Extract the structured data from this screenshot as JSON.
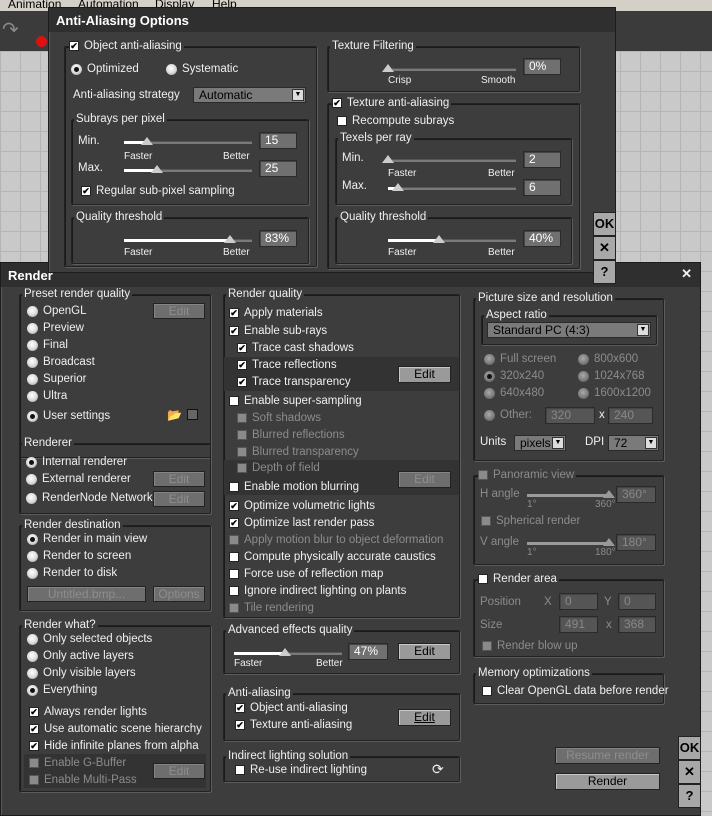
{
  "menu": [
    "Animation",
    "Automation",
    "Display",
    "Help"
  ],
  "aa": {
    "title": "Anti-Aliasing Options",
    "object_aa": {
      "label": "Object anti-aliasing",
      "checked": true
    },
    "optimized": {
      "label": "Optimized",
      "selected": true
    },
    "systematic": {
      "label": "Systematic",
      "selected": false
    },
    "strategy_label": "Anti-aliasing strategy",
    "strategy_value": "Automatic",
    "subrays_title": "Subrays per pixel",
    "min_label": "Min.",
    "max_label": "Max.",
    "faster": "Faster",
    "better": "Better",
    "subrays_min": {
      "value": "15",
      "fraction": 0.18
    },
    "subrays_max": {
      "value": "25",
      "fraction": 0.26
    },
    "regular_sampling": {
      "label": "Regular sub-pixel sampling",
      "checked": true
    },
    "quality_title": "Quality threshold",
    "object_quality": {
      "value": "83%",
      "fraction": 0.83
    },
    "texture_filtering_title": "Texture Filtering",
    "crisp": "Crisp",
    "smooth": "Smooth",
    "texture_filtering": {
      "value": "0%",
      "fraction": 0.0
    },
    "texture_aa": {
      "label": "Texture anti-aliasing",
      "checked": true
    },
    "recompute": {
      "label": "Recompute subrays",
      "checked": false
    },
    "texels_title": "Texels per ray",
    "texels_min": {
      "value": "2",
      "fraction": 0.0
    },
    "texels_max": {
      "value": "6",
      "fraction": 0.08
    },
    "texture_quality": {
      "value": "40%",
      "fraction": 0.4
    },
    "ok": "OK",
    "cancel": "✕",
    "help": "?"
  },
  "render": {
    "title": "Render",
    "close": "✕",
    "preset_title": "Preset render quality",
    "presets": [
      {
        "label": "OpenGL",
        "selected": false
      },
      {
        "label": "Preview",
        "selected": false
      },
      {
        "label": "Final",
        "selected": false
      },
      {
        "label": "Broadcast",
        "selected": false
      },
      {
        "label": "Superior",
        "selected": false
      },
      {
        "label": "Ultra",
        "selected": false
      },
      {
        "label": "User settings",
        "selected": true
      }
    ],
    "edit": {
      "label": "Edit",
      "disabled": true
    },
    "edit_on": {
      "label": "Edit",
      "disabled": false
    },
    "renderer_title": "Renderer",
    "renderers": [
      {
        "label": "Internal renderer",
        "selected": true
      },
      {
        "label": "External renderer",
        "selected": false
      },
      {
        "label": "RenderNode Network",
        "selected": false
      }
    ],
    "dest_title": "Render destination",
    "destinations": [
      {
        "label": "Render in main view",
        "selected": true
      },
      {
        "label": "Render to screen",
        "selected": false
      },
      {
        "label": "Render to disk",
        "selected": false
      }
    ],
    "filename": {
      "label": "Untitled.bmp...",
      "disabled": true
    },
    "options": {
      "label": "Options",
      "disabled": true
    },
    "what_title": "Render what?",
    "what": [
      {
        "label": "Only selected objects",
        "selected": false
      },
      {
        "label": "Only active layers",
        "selected": false
      },
      {
        "label": "Only visible layers",
        "selected": false
      },
      {
        "label": "Everything",
        "selected": true
      }
    ],
    "what_checks": [
      {
        "label": "Always render lights",
        "checked": true
      },
      {
        "label": "Use automatic scene hierarchy",
        "checked": true
      },
      {
        "label": "Hide infinite planes from alpha",
        "checked": true
      },
      {
        "label": "Enable G-Buffer",
        "checked": false,
        "disabled": true
      },
      {
        "label": "Enable Multi-Pass",
        "checked": false,
        "disabled": true
      }
    ],
    "quality_title": "Render quality",
    "quality": [
      {
        "label": "Apply materials",
        "checked": true
      },
      {
        "label": "Enable sub-rays",
        "checked": true
      },
      {
        "label": "Trace cast shadows",
        "checked": true
      },
      {
        "label": "Trace reflections",
        "checked": true
      },
      {
        "label": "Trace transparency",
        "checked": true
      },
      {
        "label": "Enable super-sampling",
        "checked": false
      },
      {
        "label": "Soft shadows",
        "checked": false,
        "disabled": true
      },
      {
        "label": "Blurred reflections",
        "checked": false,
        "disabled": true
      },
      {
        "label": "Blurred transparency",
        "checked": false,
        "disabled": true
      },
      {
        "label": "Depth of field",
        "checked": false,
        "disabled": true
      },
      {
        "label": "Enable motion blurring",
        "checked": false
      },
      {
        "label": "Optimize volumetric lights",
        "checked": true
      },
      {
        "label": "Optimize last render pass",
        "checked": true
      },
      {
        "label": "Apply motion blur to object deformation",
        "checked": false,
        "disabled": true
      },
      {
        "label": "Compute physically accurate caustics",
        "checked": false
      },
      {
        "label": "Force use of reflection map",
        "checked": false
      },
      {
        "label": "Ignore indirect lighting on plants",
        "checked": false
      },
      {
        "label": "Tile rendering",
        "checked": false,
        "disabled": true
      }
    ],
    "advanced_title": "Advanced effects quality",
    "faster": "Faster",
    "better": "Better",
    "advanced": {
      "value": "47%",
      "fraction": 0.47
    },
    "aa_title": "Anti-aliasing",
    "aa_checks": [
      {
        "label": "Object anti-aliasing",
        "checked": true
      },
      {
        "label": "Texture anti-aliasing",
        "checked": true
      }
    ],
    "indirect_title": "Indirect lighting solution",
    "reuse_indirect": {
      "label": "Re-use indirect lighting",
      "checked": false
    },
    "picture_title": "Picture size and resolution",
    "aspect_title": "Aspect ratio",
    "aspect_value": "Standard PC (4:3)",
    "sizes": [
      {
        "label": "Full screen",
        "selected": false,
        "disabled": true
      },
      {
        "label": "320x240",
        "selected": true,
        "disabled": true
      },
      {
        "label": "640x480",
        "selected": false,
        "disabled": true
      },
      {
        "label": "800x600",
        "selected": false,
        "disabled": true
      },
      {
        "label": "1024x768",
        "selected": false,
        "disabled": true
      },
      {
        "label": "1600x1200",
        "selected": false,
        "disabled": true
      },
      {
        "label": "Other:",
        "selected": false,
        "disabled": true
      }
    ],
    "other_w": "320",
    "other_h": "240",
    "times": "x",
    "units_label": "Units",
    "units_value": "pixels",
    "dpi_label": "DPI",
    "dpi_value": "72",
    "panoramic": {
      "label": "Panoramic view",
      "checked": false,
      "disabled": true
    },
    "h_angle_label": "H angle",
    "h_angle": {
      "value": "360°",
      "fraction": 1.0
    },
    "h_min": "1°",
    "h_max": "360°",
    "spherical": {
      "label": "Spherical render",
      "checked": false,
      "disabled": true
    },
    "v_angle_label": "V angle",
    "v_angle": {
      "value": "180°",
      "fraction": 1.0
    },
    "v_min": "1°",
    "v_max": "180°",
    "render_area": {
      "label": "Render area",
      "checked": false
    },
    "position_label": "Position",
    "x_label": "X",
    "y_label": "Y",
    "pos_x": "0",
    "pos_y": "0",
    "size_label": "Size",
    "size_w": "491",
    "size_h": "368",
    "blow_up": {
      "label": "Render blow up",
      "checked": false,
      "disabled": true
    },
    "memory_title": "Memory optimizations",
    "clear_opengl": {
      "label": "Clear OpenGL data before render",
      "checked": false
    },
    "resume": {
      "label": "Resume render",
      "disabled": true
    },
    "render_btn": {
      "label": "Render",
      "disabled": false
    },
    "ok": "OK",
    "cancel": "✕",
    "help": "?"
  }
}
